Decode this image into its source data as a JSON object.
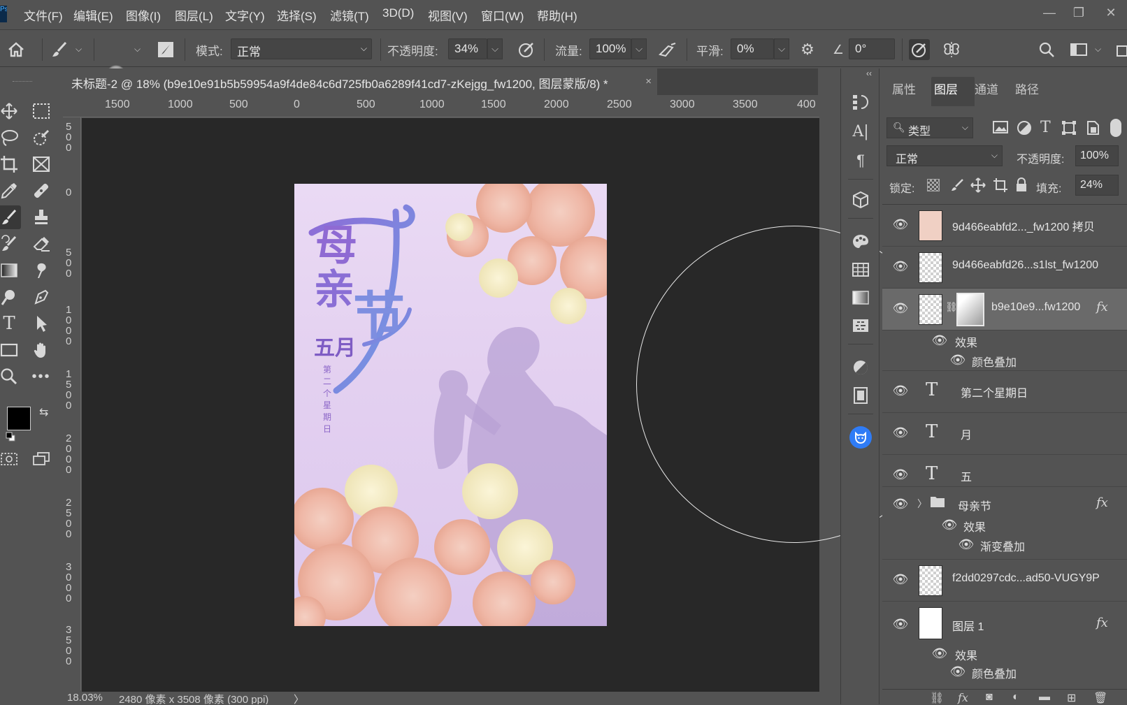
{
  "app": {
    "logo_text": "Ps"
  },
  "menu": {
    "items": [
      "文件(F)",
      "编辑(E)",
      "图像(I)",
      "图层(L)",
      "文字(Y)",
      "选择(S)",
      "滤镜(T)",
      "3D(D)",
      "视图(V)",
      "窗口(W)",
      "帮助(H)"
    ]
  },
  "window_controls": {
    "minimize": "—",
    "restore": "❐",
    "close": "✕"
  },
  "options": {
    "brush_size": "2069",
    "mode_label": "模式:",
    "mode_value": "正常",
    "opacity_label": "不透明度:",
    "opacity_value": "34%",
    "flow_label": "流量:",
    "flow_value": "100%",
    "smoothing_label": "平滑:",
    "smoothing_value": "0%",
    "angle_value": "0°"
  },
  "document": {
    "tab_title": "未标题-2 @ 18% (b9e10e91b5b59954a9f4de84c6d725fb0a6289f41cd7-zKejgg_fw1200, 图层蒙版/8) *",
    "close": "×",
    "zoom": "18.03%",
    "info": "2480 像素 x 3508 像素 (300 ppi)",
    "info_caret": "〉"
  },
  "rulers": {
    "top": [
      "1500",
      "1000",
      "500",
      "0",
      "500",
      "1000",
      "1500",
      "2000",
      "2500",
      "3000",
      "3500",
      "400"
    ],
    "left": [
      "5 0 0",
      "0",
      "5 0 0",
      "1 0 0 0",
      "1 5 0 0",
      "2 0 0 0",
      "2 5 0 0",
      "3 0 0 0",
      "3 5 0 0"
    ]
  },
  "artwork": {
    "title_glyph_1": "母",
    "title_glyph_2": "亲",
    "title_glyph_3": "节",
    "month": "五月",
    "subtitle_chars": [
      "第",
      "二",
      "个",
      "星",
      "期",
      "日"
    ]
  },
  "panel": {
    "tabs": [
      "属性",
      "图层",
      "通道",
      "路径"
    ],
    "filter_label": "类型",
    "blend_mode": "正常",
    "opacity_label": "不透明度:",
    "opacity_value": "100%",
    "lock_label": "锁定:",
    "fill_label": "填充:",
    "fill_value": "24%",
    "collapse": "‹‹"
  },
  "layers": [
    {
      "name": "9d466eabfd2..._fw1200 拷贝"
    },
    {
      "name": "9d466eabfd26...s1lst_fw1200"
    },
    {
      "name": "b9e10e9...fw1200",
      "fx": "fx",
      "effects_label": "效果",
      "effect": "颜色叠加"
    },
    {
      "name": "第二个星期日",
      "type_glyph": "T"
    },
    {
      "name": "月",
      "type_glyph": "T"
    },
    {
      "name": "五",
      "type_glyph": "T"
    },
    {
      "name": "母亲节",
      "fx": "fx",
      "effects_label": "效果",
      "effect": "渐变叠加"
    },
    {
      "name": "f2dd0297cdc...ad50-VUGY9P"
    },
    {
      "name": "图层 1",
      "fx": "fx",
      "effects_label": "效果",
      "effect": "颜色叠加"
    }
  ],
  "icons": {
    "home": "home-icon",
    "brush": "brush-icon",
    "eye": "eye-icon"
  }
}
